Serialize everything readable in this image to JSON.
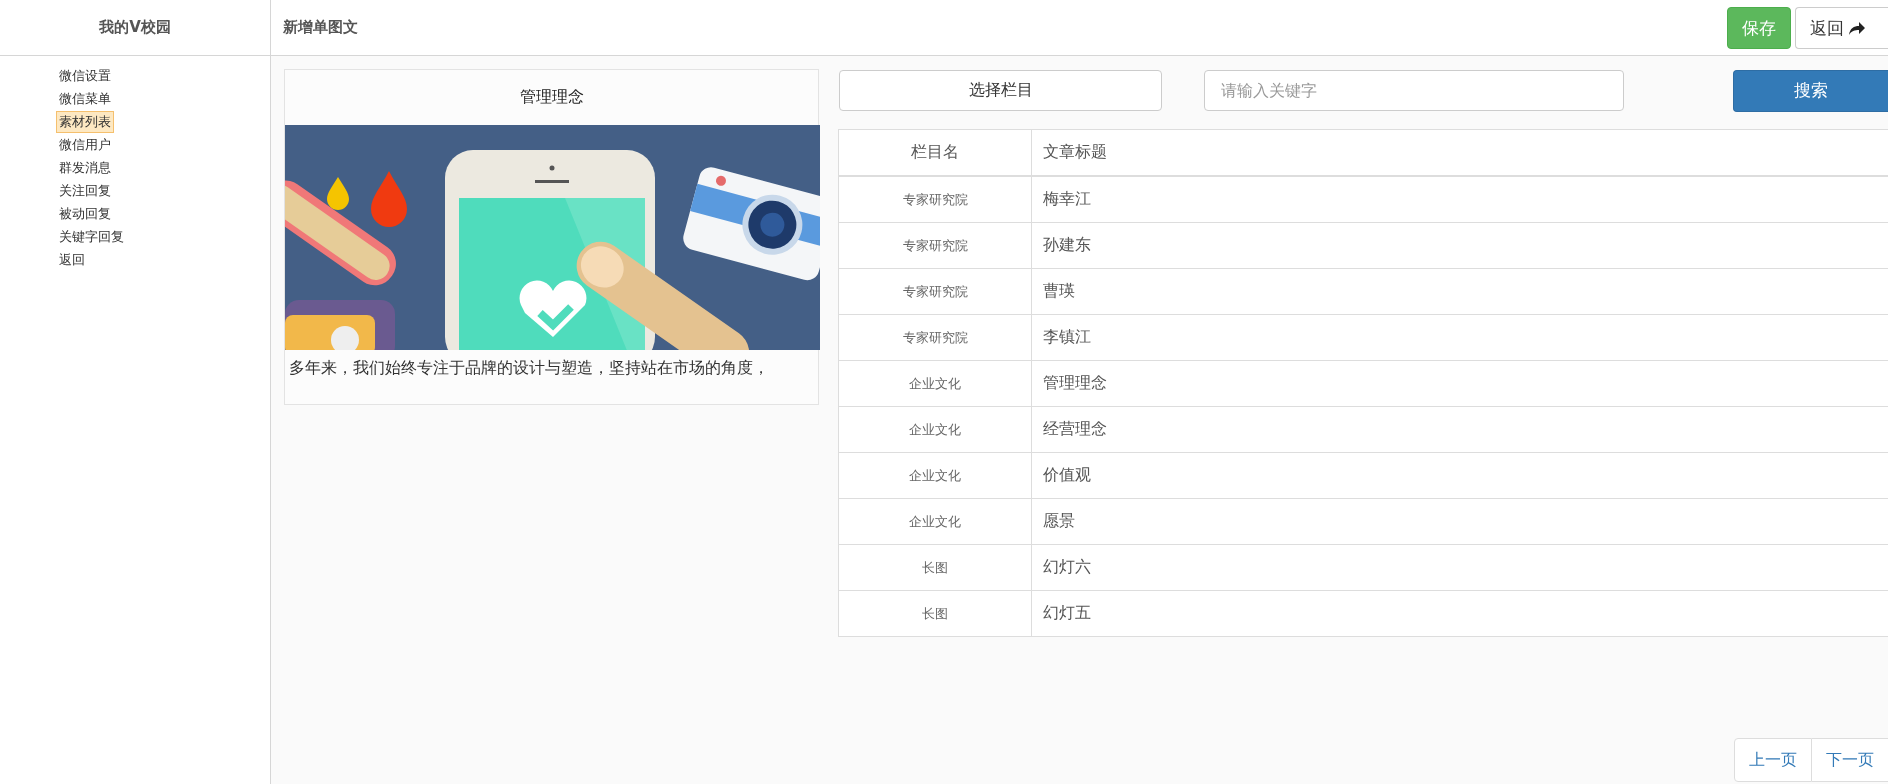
{
  "sidebar": {
    "title": "我的V校园",
    "items": [
      {
        "label": "微信设置",
        "selected": false
      },
      {
        "label": "微信菜单",
        "selected": false
      },
      {
        "label": "素材列表",
        "selected": true
      },
      {
        "label": "微信用户",
        "selected": false
      },
      {
        "label": "群发消息",
        "selected": false
      },
      {
        "label": "关注回复",
        "selected": false
      },
      {
        "label": "被动回复",
        "selected": false
      },
      {
        "label": "关键字回复",
        "selected": false
      },
      {
        "label": "返回",
        "selected": false
      }
    ]
  },
  "header": {
    "title": "新增单图文",
    "save_button": "保存",
    "back_button": "返回"
  },
  "preview": {
    "title": "管理理念",
    "summary": "多年来，我们始终专注于品牌的设计与塑造，坚持站在市场的角度，"
  },
  "toolbar": {
    "category_button": "选择栏目",
    "search": {
      "placeholder": "请输入关键字"
    },
    "search_button": "搜索"
  },
  "table": {
    "columns": [
      "栏目名",
      "文章标题"
    ],
    "rows": [
      [
        "专家研究院",
        "梅幸江"
      ],
      [
        "专家研究院",
        "孙建东"
      ],
      [
        "专家研究院",
        "曹瑛"
      ],
      [
        "专家研究院",
        "李镇江"
      ],
      [
        "企业文化",
        "管理理念"
      ],
      [
        "企业文化",
        "经营理念"
      ],
      [
        "企业文化",
        "价值观"
      ],
      [
        "企业文化",
        "愿景"
      ],
      [
        "长图",
        "幻灯六"
      ],
      [
        "长图",
        "幻灯五"
      ]
    ]
  },
  "pagination": {
    "previous": "上一页",
    "next": "下一页"
  }
}
